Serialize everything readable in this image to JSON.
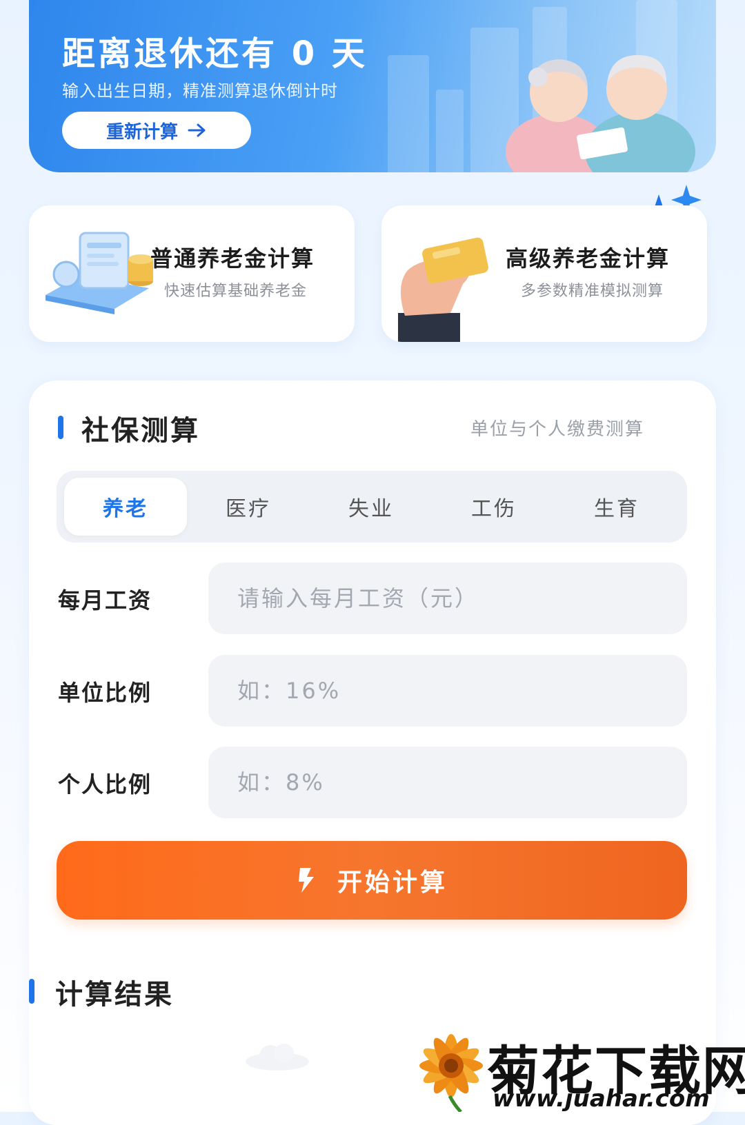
{
  "banner": {
    "title": "距离退休还有 0 天",
    "subtitle": "输入出生日期，精准测算退休倒计时",
    "recalc_label": "重新计算"
  },
  "cards": [
    {
      "title": "普通养老金计算",
      "subtitle": "快速估算基础养老金"
    },
    {
      "title": "高级养老金计算",
      "subtitle": "多参数精准模拟测算"
    }
  ],
  "social": {
    "title": "社保测算",
    "right_label": "单位与个人缴费测算",
    "tabs": [
      "养老",
      "医疗",
      "失业",
      "工伤",
      "生育"
    ],
    "active_tab": "养老",
    "fields": [
      {
        "label": "每月工资",
        "placeholder": "请输入每月工资（元）",
        "value": ""
      },
      {
        "label": "单位比例",
        "placeholder": "如：16%",
        "value": ""
      },
      {
        "label": "个人比例",
        "placeholder": "如：8%",
        "value": ""
      }
    ],
    "start_label": "开始计算"
  },
  "result": {
    "title": "计算结果"
  },
  "watermark": {
    "brand": "菊花下载网",
    "url": "www.juahar.com"
  },
  "colors": {
    "primary": "#1e74e8",
    "accent": "#ff6a1a",
    "banner": "#2f86ec"
  }
}
